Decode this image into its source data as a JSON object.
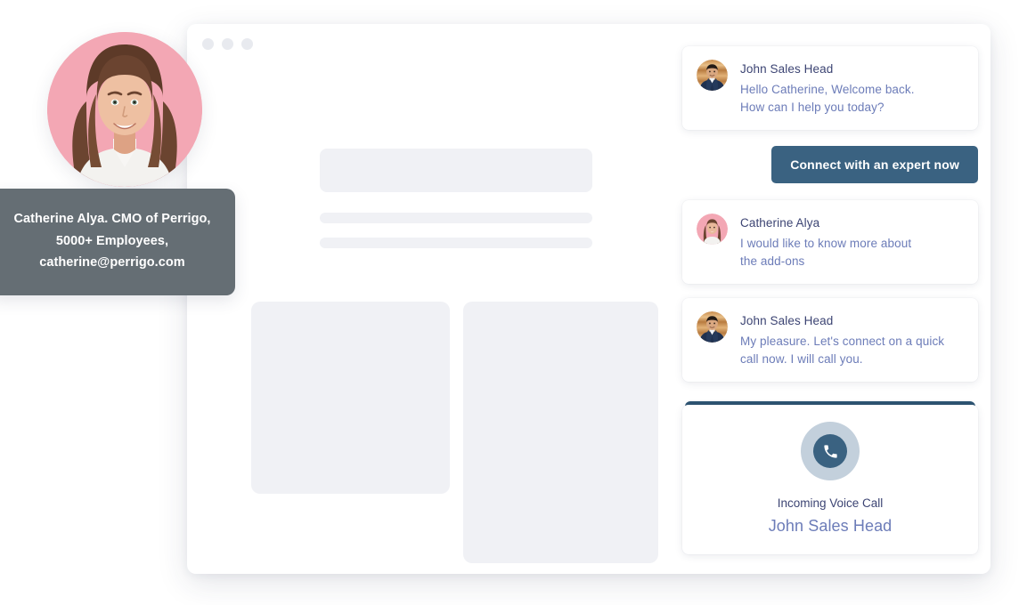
{
  "window": {
    "dots": [
      "window-dot-1",
      "window-dot-2",
      "window-dot-3"
    ]
  },
  "profile": {
    "avatar_alt": "Catherine Alya portrait",
    "tooltip_lines": [
      "Catherine Alya. CMO of Perrigo,",
      "5000+ Employees,",
      "catherine@perrigo.com"
    ]
  },
  "chat": {
    "messages": [
      {
        "sender": "John Sales Head",
        "avatar": "john-avatar",
        "lines": [
          "Hello Catherine, Welcome back.",
          "How can I help you today?"
        ]
      },
      {
        "sender": "Catherine Alya",
        "avatar": "catherine-avatar",
        "lines": [
          "I would like to know more about",
          "the add-ons"
        ]
      },
      {
        "sender": "John Sales Head",
        "avatar": "john-avatar",
        "lines": [
          "My pleasure. Let's connect on a quick",
          "call now. I will call you."
        ]
      }
    ],
    "cta_label": "Connect with an expert now"
  },
  "call": {
    "icon": "phone-icon",
    "status_label": "Incoming Voice Call",
    "caller_name": "John Sales Head"
  },
  "colors": {
    "accent_button": "#3a6281",
    "call_accent_bar": "#2d5472",
    "name_text": "#3c4473",
    "body_text": "#6c7cb8",
    "tooltip_bg": "#656e74",
    "avatar_pink": "#f3a7b4",
    "skeleton": "#f0f1f5",
    "phone_ring": "#c3d0dc"
  }
}
